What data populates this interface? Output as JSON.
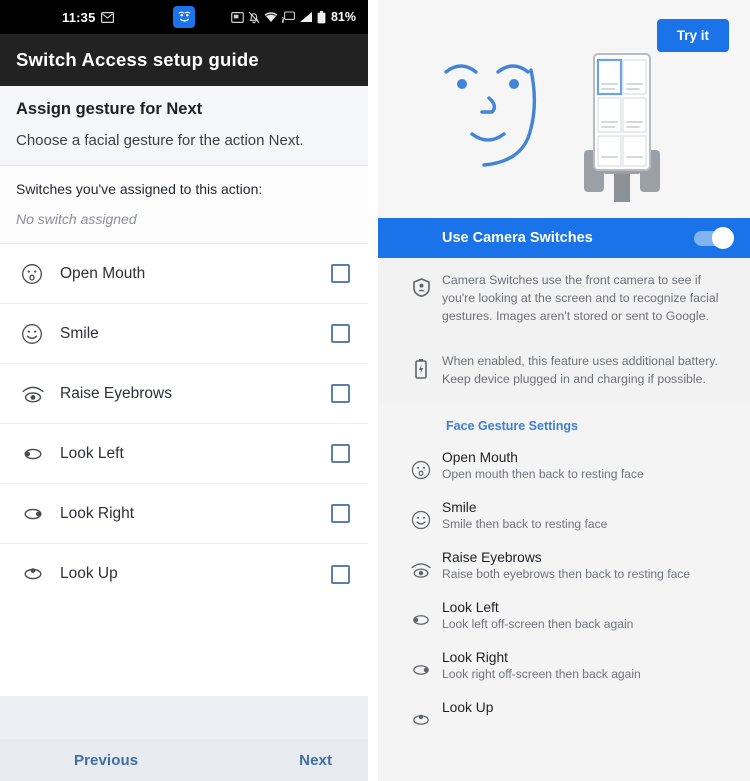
{
  "left_panel": {
    "status_bar": {
      "time": "11:35",
      "battery_percent": "81%",
      "icons": [
        "message-icon",
        "camera-switches-face-icon",
        "screenshot-icon",
        "notifications-muted-icon",
        "wifi-icon",
        "cast-icon",
        "signal-icon",
        "battery-icon"
      ]
    },
    "app_bar": {
      "title": "Switch Access setup guide"
    },
    "intro": {
      "heading": "Assign gesture for Next",
      "description": "Choose a facial gesture for the action Next."
    },
    "assigned": {
      "label": "Switches you've assigned to this action:",
      "value": "No switch assigned"
    },
    "gestures": [
      {
        "label": "Open Mouth",
        "icon": "open-mouth-face-icon",
        "checked": false
      },
      {
        "label": "Smile",
        "icon": "smile-face-icon",
        "checked": false
      },
      {
        "label": "Raise Eyebrows",
        "icon": "raise-eyebrows-eye-icon",
        "checked": false
      },
      {
        "label": "Look Left",
        "icon": "look-left-eye-icon",
        "checked": false
      },
      {
        "label": "Look Right",
        "icon": "look-right-eye-icon",
        "checked": false
      },
      {
        "label": "Look Up",
        "icon": "look-up-eye-icon",
        "checked": false
      }
    ],
    "footer": {
      "previous": "Previous",
      "next": "Next"
    }
  },
  "right_panel": {
    "hero": {
      "try_it_label": "Try it",
      "illustration": "face-looking-at-phone-on-stand"
    },
    "toggle": {
      "label": "Use Camera Switches",
      "state": "on"
    },
    "info": [
      {
        "icon": "privacy-shield-icon",
        "text": "Camera Switches use the front camera to see if you're looking at the screen and to recognize facial gestures. Images aren't stored or sent to Google."
      },
      {
        "icon": "battery-charging-icon",
        "text": "When enabled, this feature uses additional battery. Keep device plugged in and charging if possible."
      }
    ],
    "section_header": "Face Gesture Settings",
    "gestures": [
      {
        "title": "Open Mouth",
        "subtitle": "Open mouth then back to resting face",
        "icon": "open-mouth-face-icon"
      },
      {
        "title": "Smile",
        "subtitle": "Smile then back to resting face",
        "icon": "smile-face-icon"
      },
      {
        "title": "Raise Eyebrows",
        "subtitle": "Raise both eyebrows then back to resting face",
        "icon": "raise-eyebrows-eye-icon"
      },
      {
        "title": "Look Left",
        "subtitle": "Look left off-screen then back again",
        "icon": "look-left-eye-icon"
      },
      {
        "title": "Look Right",
        "subtitle": "Look right off-screen then back again",
        "icon": "look-right-eye-icon"
      },
      {
        "title": "Look Up",
        "subtitle": "",
        "icon": "look-up-eye-icon"
      }
    ]
  },
  "colors": {
    "accent_blue": "#1a73e8",
    "link_blue": "#3d6fa5",
    "section_blue": "#3d7fd6",
    "appbar_dark": "#222222",
    "checkbox_border": "#5b7fa6"
  }
}
